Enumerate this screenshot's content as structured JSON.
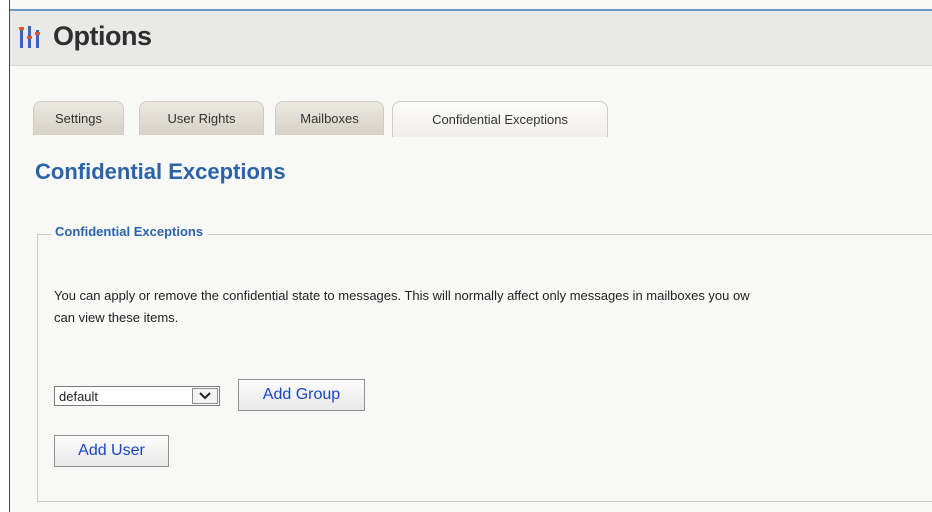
{
  "header": {
    "title": "Options",
    "icon": "options-icon"
  },
  "tabs": [
    {
      "label": "Settings"
    },
    {
      "label": "User Rights"
    },
    {
      "label": "Mailboxes"
    },
    {
      "label": "Confidential Exceptions",
      "active": true
    }
  ],
  "page": {
    "title": "Confidential Exceptions"
  },
  "section": {
    "legend": "Confidential Exceptions",
    "description_line1": "You can apply or remove the confidential state to messages. This will normally affect only messages in mailboxes you ow",
    "description_line2": "can view these items."
  },
  "group_select": {
    "value": "default",
    "icon": "chevron-down-icon"
  },
  "buttons": {
    "add_group": "Add Group",
    "add_user": "Add User"
  },
  "colors": {
    "accent": "#2a63a8",
    "button_text": "#1a44c4",
    "top_rule": "#6f96c8"
  }
}
